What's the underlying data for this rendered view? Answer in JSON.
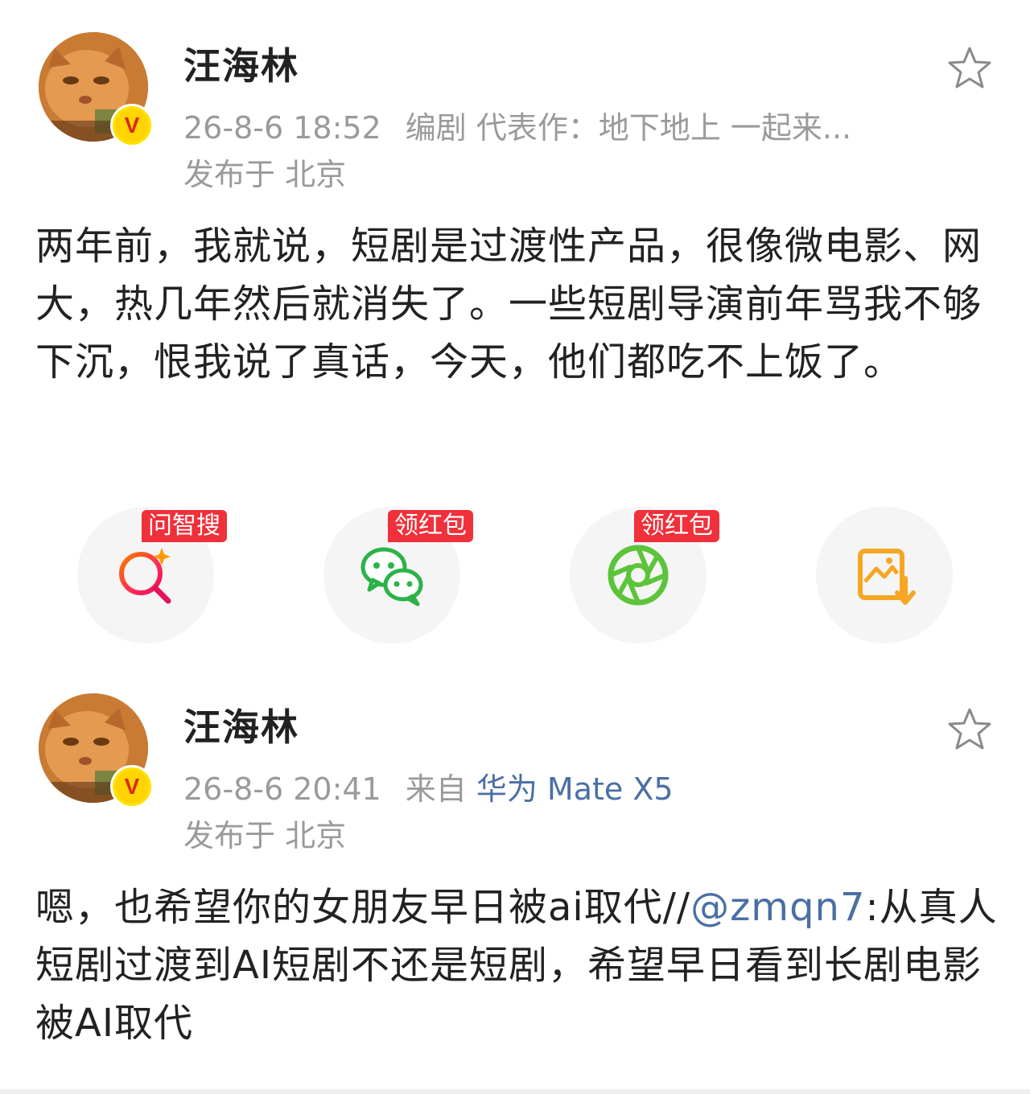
{
  "posts": [
    {
      "username": "汪海林",
      "time": "26-8-6 18:52",
      "meta_extra": "编剧 代表作：地下地上 一起来...",
      "location": "发布于 北京",
      "body": "两年前，我就说，短剧是过渡性产品，很像微电影、网大，热几年然后就消失了。一些短剧导演前年骂我不够下沉，恨我说了真话，今天，他们都吃不上饭了。",
      "badge": "V"
    },
    {
      "username": "汪海林",
      "time": "26-8-6 20:41",
      "source_prefix": "来自",
      "source_device": "华为 Mate X5",
      "location": "发布于 北京",
      "body_before": "嗯，也希望你的女朋友早日被ai取代//",
      "mention": "@zmqn7",
      "body_after": ":从真人短剧过渡到AI短剧不还是短剧，希望早日看到长剧电影被AI取代",
      "badge": "V"
    }
  ],
  "share": {
    "search_tag": "问智搜",
    "wechat_tag": "领红包",
    "moments_tag": "领红包",
    "icons": [
      "ai-search-icon",
      "wechat-icon",
      "moments-icon",
      "save-image-icon"
    ]
  },
  "colors": {
    "link": "#4a6fa5",
    "meta": "#9a9a9a",
    "tag_red": "#f0303a",
    "wechat_green": "#2bb34a",
    "moments_green": "#5cc43a",
    "save_orange": "#f5a623"
  }
}
